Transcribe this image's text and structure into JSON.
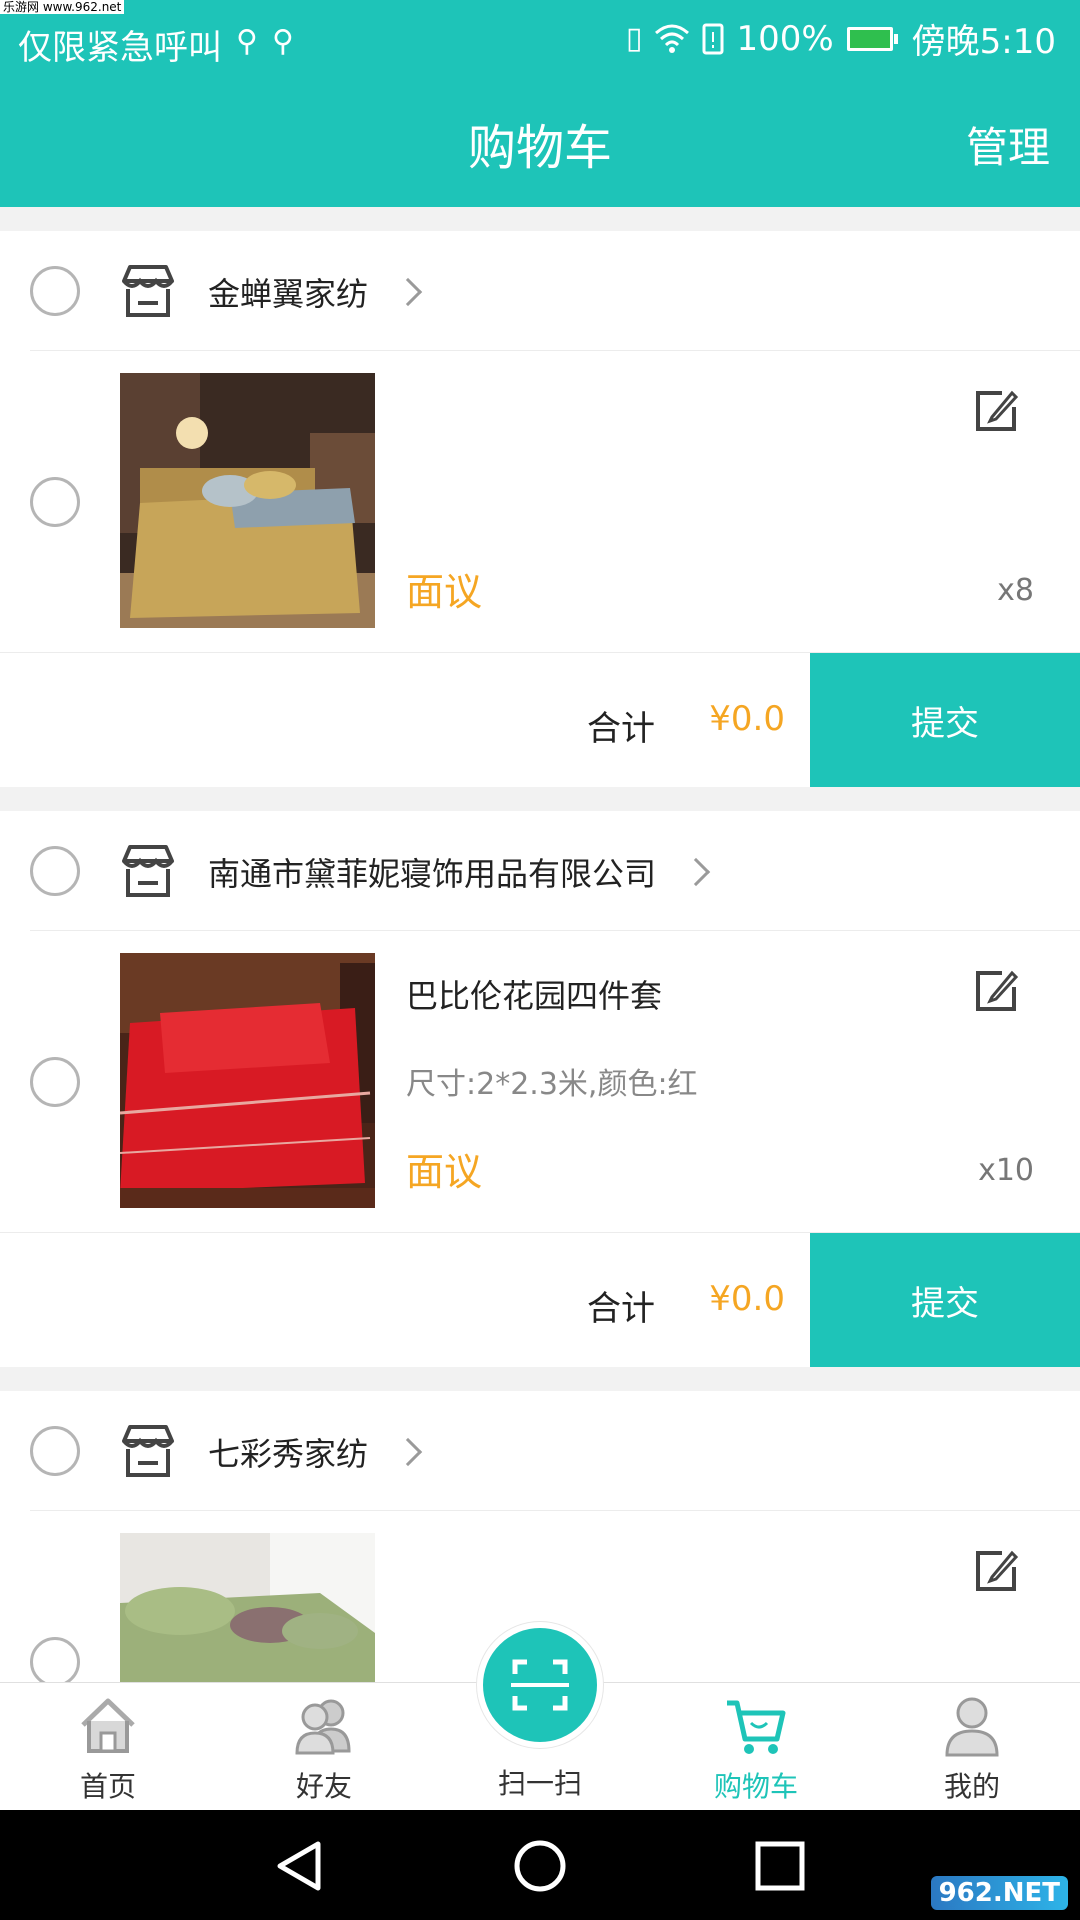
{
  "status_bar": {
    "watermark": "乐游网 www.962.net",
    "carrier_text": "仅限紧急呼叫",
    "battery": "100%",
    "time": "傍晚5:10"
  },
  "header": {
    "title": "购物车",
    "manage_label": "管理"
  },
  "shops": [
    {
      "name": "金蝉翼家纺",
      "item": {
        "name": "",
        "spec": "",
        "price": "面议",
        "qty": "x8",
        "image": "bedding-gold"
      },
      "total_label": "合计",
      "total_value": "¥0.0",
      "submit_label": "提交"
    },
    {
      "name": "南通市黛菲妮寝饰用品有限公司",
      "item": {
        "name": "巴比伦花园四件套",
        "spec": "尺寸:2*2.3米,颜色:红",
        "price": "面议",
        "qty": "x10",
        "image": "bedding-red"
      },
      "total_label": "合计",
      "total_value": "¥0.0",
      "submit_label": "提交"
    },
    {
      "name": "七彩秀家纺",
      "item": {
        "name": "",
        "spec": "",
        "price": "",
        "qty": "",
        "image": "bedding-green"
      }
    }
  ],
  "tabbar": {
    "items": [
      {
        "label": "首页",
        "icon": "home-icon"
      },
      {
        "label": "好友",
        "icon": "friends-icon"
      },
      {
        "label": "扫一扫",
        "icon": "scan-icon"
      },
      {
        "label": "购物车",
        "icon": "cart-icon",
        "active": true
      },
      {
        "label": "我的",
        "icon": "profile-icon"
      }
    ]
  },
  "colors": {
    "accent": "#1ec4b8",
    "price": "#f5a623"
  },
  "corner_watermark": "962.NET"
}
